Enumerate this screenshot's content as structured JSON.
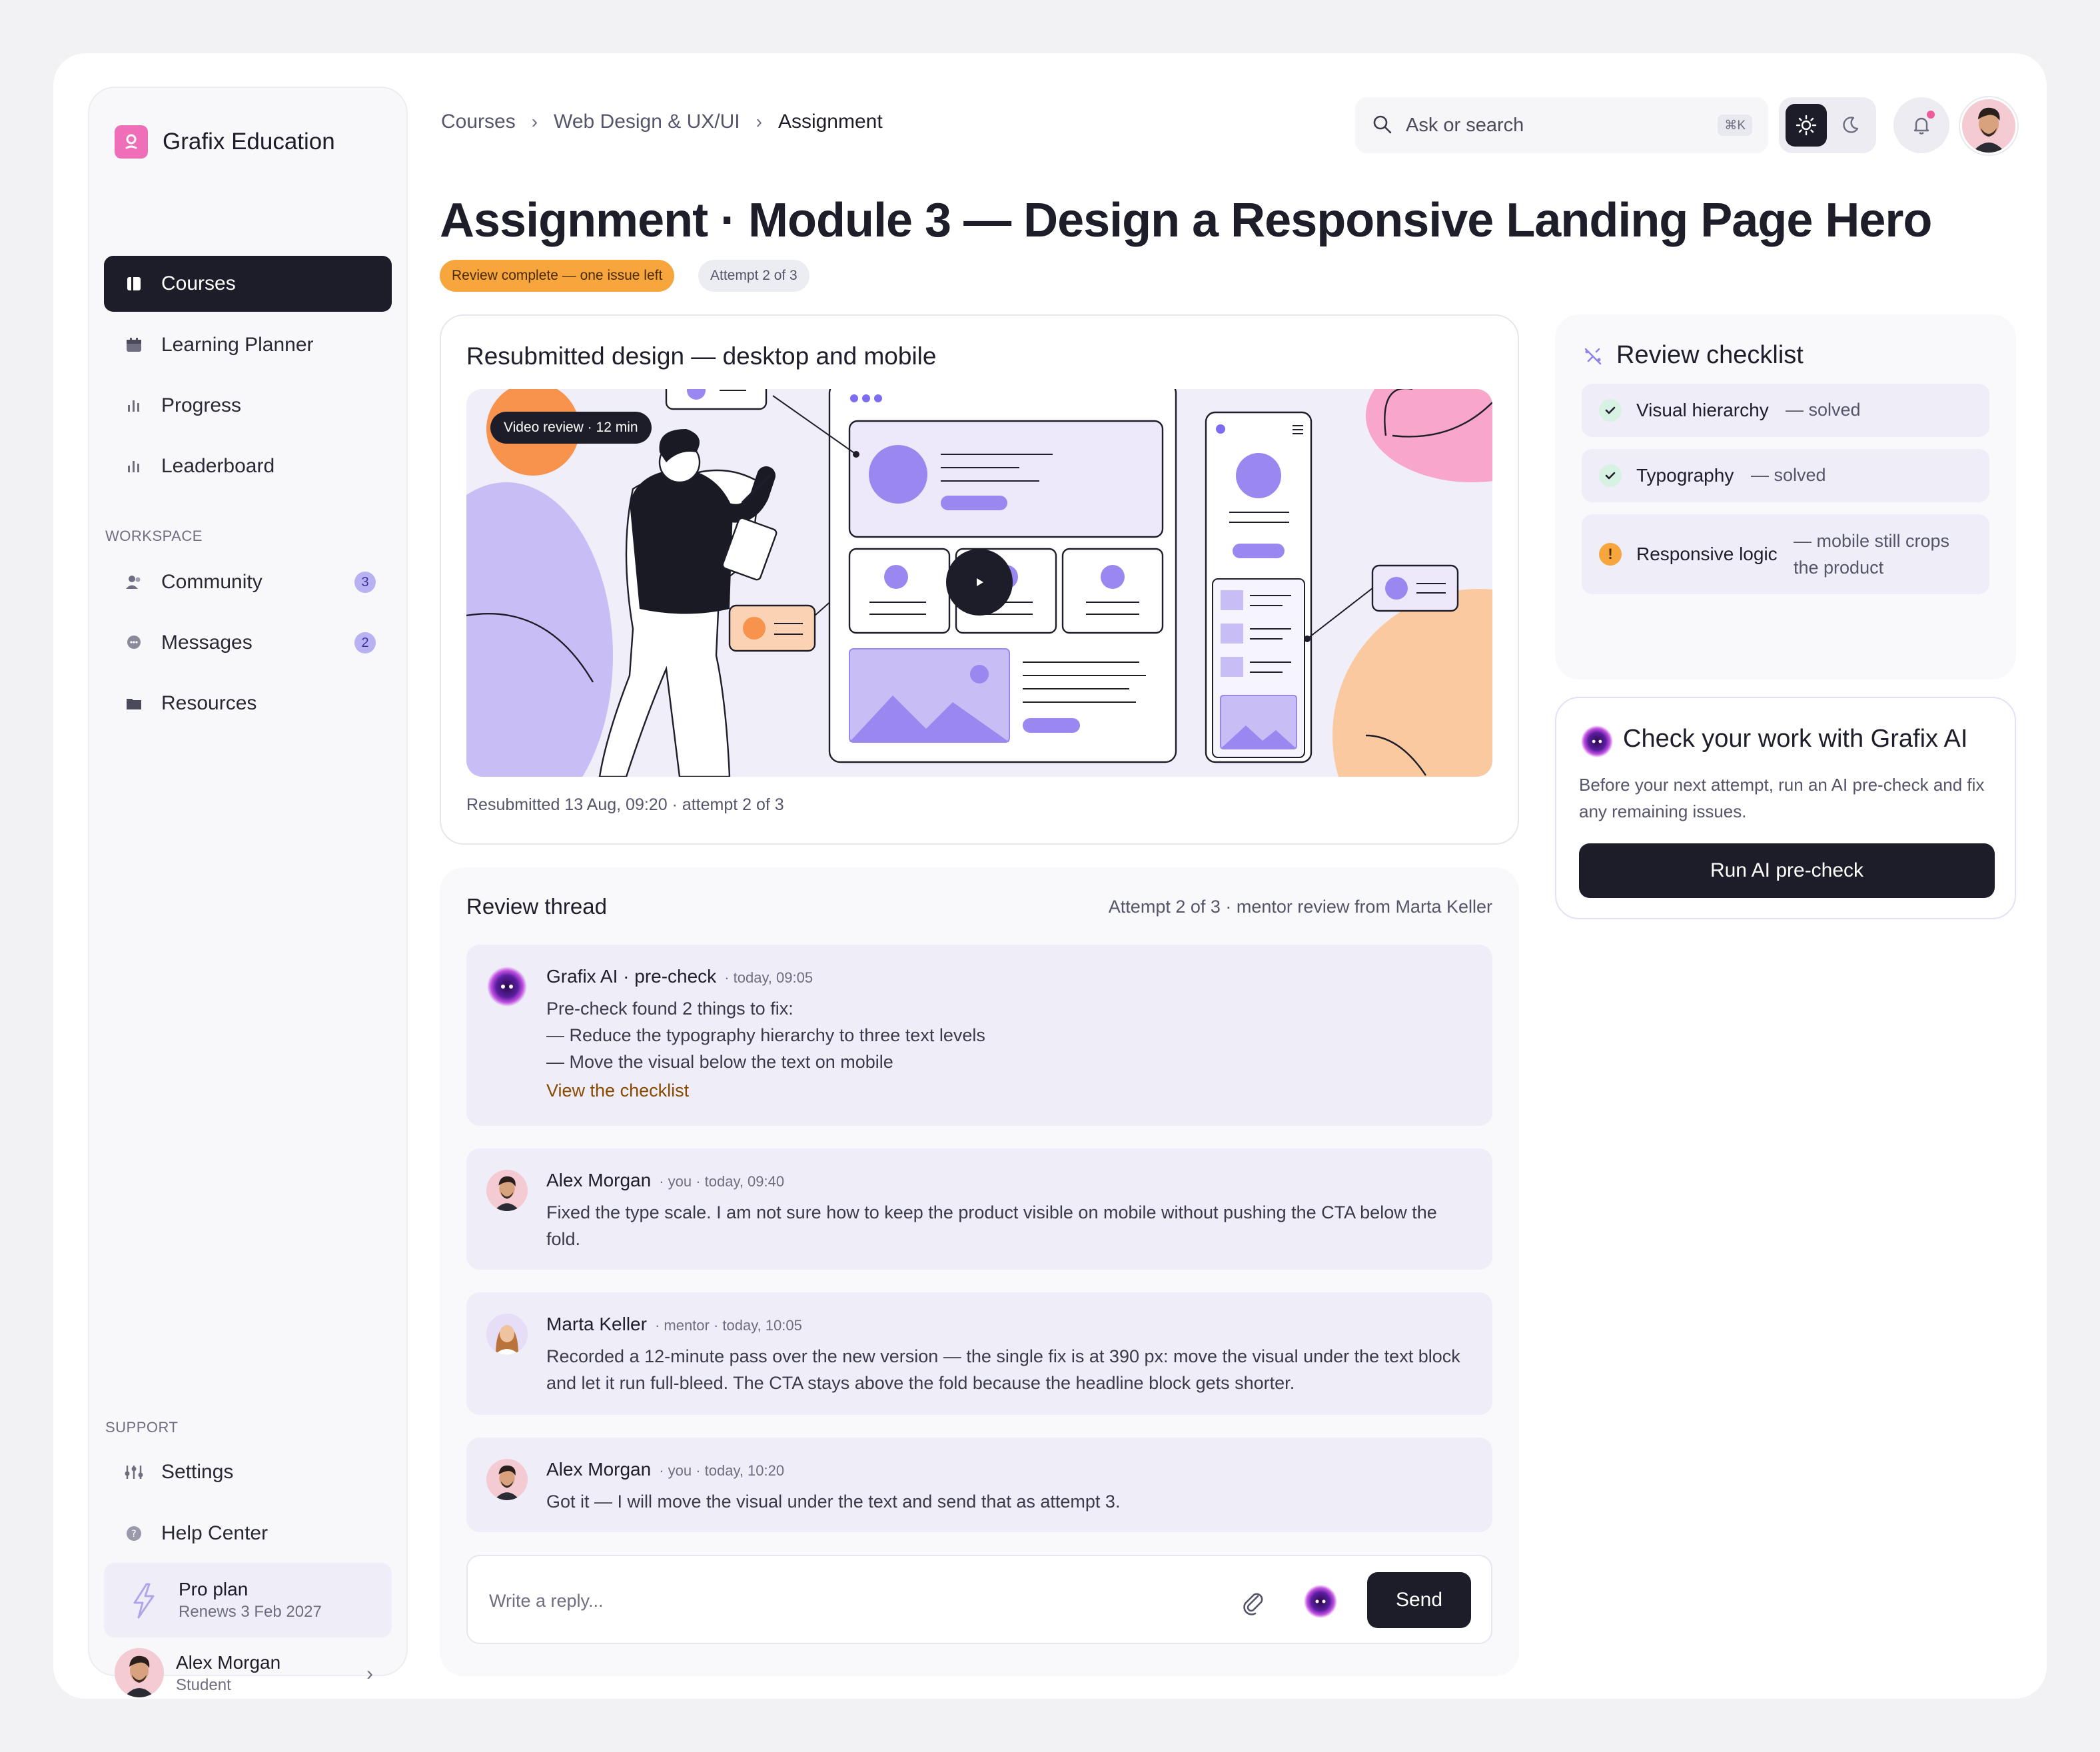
{
  "app": {
    "brand": "Grafix Education"
  },
  "sidebar": {
    "items": [
      {
        "label": "Courses",
        "icon": "book-icon",
        "active": true
      },
      {
        "label": "Learning Planner",
        "icon": "calendar-icon"
      },
      {
        "label": "Progress",
        "icon": "bar-chart-icon"
      },
      {
        "label": "Leaderboard",
        "icon": "bar-chart-icon"
      }
    ],
    "workspace_label": "WORKSPACE",
    "workspace_items": [
      {
        "label": "Community",
        "icon": "users-icon",
        "badge": "3"
      },
      {
        "label": "Messages",
        "icon": "chat-icon",
        "badge": "2"
      },
      {
        "label": "Resources",
        "icon": "folder-icon"
      }
    ],
    "support_label": "SUPPORT",
    "support_items": [
      {
        "label": "Settings",
        "icon": "sliders-icon"
      },
      {
        "label": "Help Center",
        "icon": "help-icon"
      }
    ],
    "plan": {
      "name": "Pro plan",
      "renews": "Renews 3 Feb 2027",
      "icon": "lightning-icon"
    },
    "user": {
      "name": "Alex Morgan",
      "role": "Student"
    }
  },
  "header": {
    "breadcrumb": [
      "Courses",
      "Web Design & UX/UI",
      "Assignment"
    ],
    "search_placeholder": "Ask or search",
    "search_shortcut": "⌘K"
  },
  "page": {
    "title": "Assignment · Module 3 — Design a Responsive Landing Page Hero",
    "status_badge": "Review complete — one issue left",
    "attempt_badge": "Attempt 2 of 3"
  },
  "design": {
    "title": "Resubmitted design — desktop and mobile",
    "video_chip": "Video review · 12 min",
    "caption": "Resubmitted 13 Aug, 09:20 · attempt 2 of 3"
  },
  "thread": {
    "title": "Review thread",
    "meta": "Attempt 2 of 3 · mentor review from Marta Keller",
    "messages": [
      {
        "name": "Grafix AI · pre-check",
        "when": "· today, 09:05",
        "lines": [
          "Pre-check found 2 things to fix:",
          "— Reduce the typography hierarchy to three text levels",
          "— Move the visual below the text on mobile"
        ],
        "link": "View the checklist"
      },
      {
        "name": "Alex Morgan",
        "when": "· you · today, 09:40",
        "text": "Fixed the type scale. I am not sure how to keep the product visible on mobile without pushing the CTA below the fold."
      },
      {
        "name": "Marta Keller",
        "when": "· mentor · today, 10:05",
        "text": "Recorded a 12-minute pass over the new version — the single fix is at 390 px: move the visual under the text block and let it run full-bleed. The CTA stays above the fold because the headline block gets shorter."
      },
      {
        "name": "Alex Morgan",
        "when": "· you · today, 10:20",
        "text": "Got it — I will move the visual under the text and send that as attempt 3."
      }
    ],
    "reply_placeholder": "Write a reply...",
    "send_label": "Send"
  },
  "checklist": {
    "title": "Review checklist",
    "items": [
      {
        "name": "Visual hierarchy",
        "status": "— solved",
        "state": "ok"
      },
      {
        "name": "Typography",
        "status": "— solved",
        "state": "ok"
      },
      {
        "name": "Responsive logic",
        "status": "— mobile still crops the product",
        "state": "warn"
      }
    ]
  },
  "ai_card": {
    "title": "Check your work with Grafix AI",
    "text": "Before your next attempt, run an AI pre-check and fix any remaining issues.",
    "button": "Run AI pre-check"
  },
  "colors": {
    "accent_dark": "#1d1d29",
    "warning": "#f6a63c",
    "brand_pink": "#ee6fb8",
    "lavender": "#b8b2f3"
  }
}
